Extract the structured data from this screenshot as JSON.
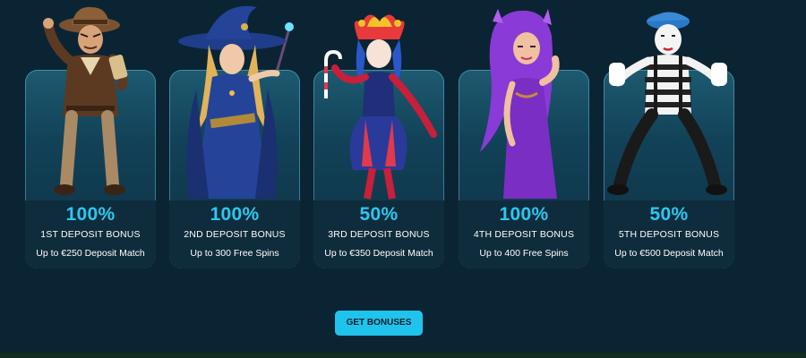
{
  "cards": [
    {
      "percent": "100%",
      "title": "1ST DEPOSIT BONUS",
      "description": "Up to €250 Deposit Match",
      "character": "explorer-character"
    },
    {
      "percent": "100%",
      "title": "2ND DEPOSIT BONUS",
      "description": "Up to 300 Free Spins",
      "character": "witch-character"
    },
    {
      "percent": "50%",
      "title": "3RD DEPOSIT BONUS",
      "description": "Up to €350 Deposit Match",
      "character": "jester-character"
    },
    {
      "percent": "100%",
      "title": "4TH DEPOSIT BONUS",
      "description": "Up to 400 Free Spins",
      "character": "purple-hair-character"
    },
    {
      "percent": "50%",
      "title": "5TH DEPOSIT BONUS",
      "description": "Up to €500 Deposit Match",
      "character": "mime-character"
    }
  ],
  "cta": {
    "label": "GET BONUSES"
  },
  "colors": {
    "background": "#0b2433",
    "accent": "#2ec7ee",
    "button": "#20c3ec",
    "panel": "#124258"
  }
}
